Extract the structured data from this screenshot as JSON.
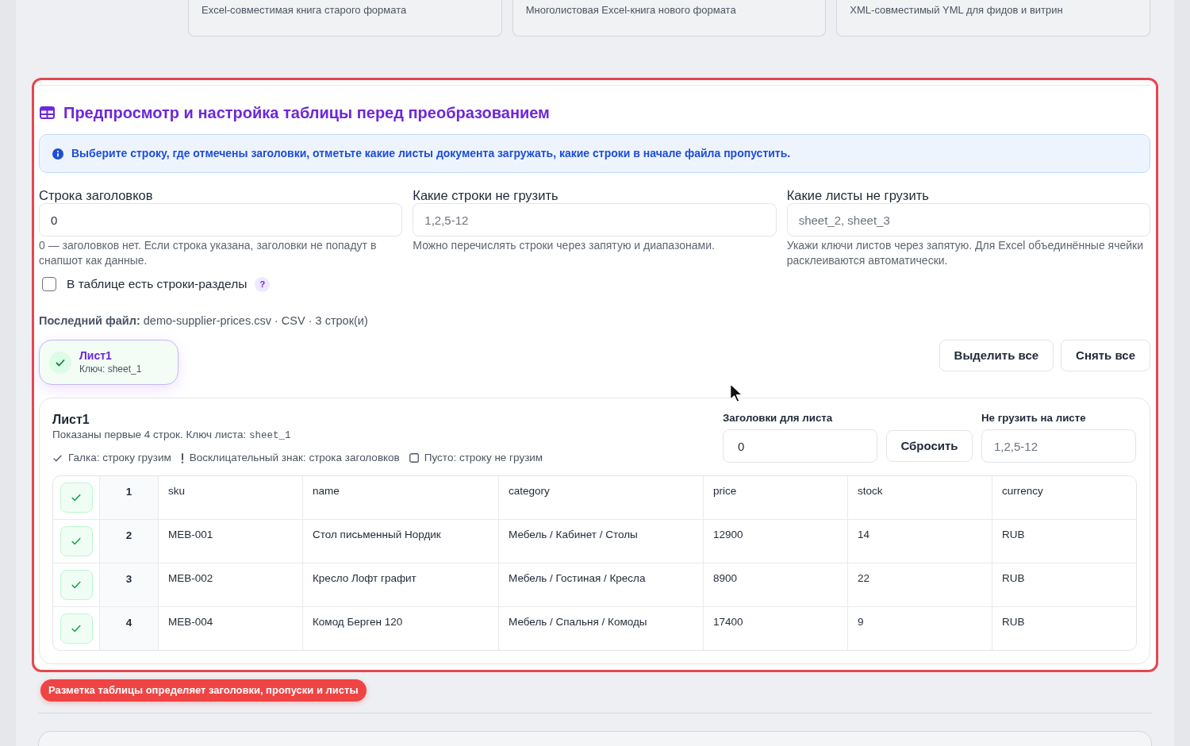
{
  "formats": [
    {
      "description": "Excel-совместимая книга старого формата"
    },
    {
      "description": "Многолистовая Excel-книга нового формата"
    },
    {
      "description": "XML-совместимый YML для фидов и витрин"
    }
  ],
  "preview": {
    "title": "Предпросмотр и настройка таблицы перед преобразованием",
    "notice": "Выберите строку, где отмечены заголовки, отметьте какие листы документа загружать, какие строки в начале файла пропустить.",
    "fields": [
      {
        "label": "Строка заголовков",
        "value": "0",
        "hint": "0 — заголовков нет. Если строка указана, заголовки не попадут в снапшот как данные."
      },
      {
        "label": "Какие строки не грузить",
        "placeholder": "1,2,5-12",
        "hint": "Можно перечислять строки через запятую и диапазонами."
      },
      {
        "label": "Какие листы не грузить",
        "placeholder": "sheet_2, sheet_3",
        "hint": "Укажи ключи листов через запятую. Для Excel объединённые ячейки расклеиваются автоматически."
      }
    ],
    "sections_checkbox": {
      "label": "В таблице есть строки-разделы",
      "checked": false,
      "help": "?"
    },
    "last_file": "**Последний файл:** demo-supplier-prices.csv · CSV · 3 строк(и)",
    "sheets": [
      {
        "name": "Лист1",
        "key": "Ключ: sheet_1",
        "selected": true
      }
    ],
    "bulk_buttons": [
      "Выделить все",
      "Снять все"
    ],
    "sheet_panel": {
      "title": "Лист1",
      "subtitle": "Показаны первые 4 строк. Ключ листа:",
      "sheet_key": "sheet_1",
      "legend": [
        {
          "kind": "load",
          "label": "Галка: строку грузим"
        },
        {
          "kind": "header",
          "label": "Восклицательный знак: строка заголовков"
        },
        {
          "kind": "skip",
          "label": "Пусто: строку не грузим"
        }
      ],
      "header_field": {
        "label": "Заголовки для листа",
        "value": "0"
      },
      "reset_button": "Сбросить",
      "skip_field": {
        "label": "Не грузить на листе",
        "placeholder": "1,2,5-12"
      },
      "table": {
        "rows": [
          {
            "number": "1",
            "loaded": true,
            "cells": [
              "sku",
              "name",
              "category",
              "price",
              "stock",
              "currency"
            ]
          },
          {
            "number": "2",
            "loaded": true,
            "cells": [
              "MEB-001",
              "Стол письменный Нордик",
              "Мебель / Кабинет / Столы",
              "12900",
              "14",
              "RUB"
            ]
          },
          {
            "number": "3",
            "loaded": true,
            "cells": [
              "MEB-002",
              "Кресло Лофт графит",
              "Мебель / Гостиная / Кресла",
              "8900",
              "22",
              "RUB"
            ]
          },
          {
            "number": "4",
            "loaded": true,
            "cells": [
              "MEB-004",
              "Комод Берген 120",
              "Мебель / Спальня / Комоды",
              "17400",
              "9",
              "RUB"
            ]
          }
        ]
      }
    }
  },
  "annotation": "Разметка таблицы определяет заголовки, пропуски и листы"
}
